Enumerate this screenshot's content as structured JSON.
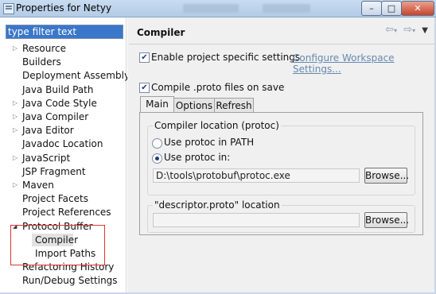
{
  "window": {
    "title": "Properties for Netyy",
    "buttons": {
      "minimize": "–",
      "maximize": "□",
      "close": "✕"
    }
  },
  "filter": {
    "value": "type filter text"
  },
  "tree": {
    "items": [
      {
        "label": "Resource",
        "expandable": true
      },
      {
        "label": "Builders",
        "expandable": false
      },
      {
        "label": "Deployment Assembly",
        "expandable": false
      },
      {
        "label": "Java Build Path",
        "expandable": false
      },
      {
        "label": "Java Code Style",
        "expandable": true
      },
      {
        "label": "Java Compiler",
        "expandable": true
      },
      {
        "label": "Java Editor",
        "expandable": true
      },
      {
        "label": "Javadoc Location",
        "expandable": false
      },
      {
        "label": "JavaScript",
        "expandable": true
      },
      {
        "label": "JSP Fragment",
        "expandable": false
      },
      {
        "label": "Maven",
        "expandable": true
      },
      {
        "label": "Project Facets",
        "expandable": false
      },
      {
        "label": "Project References",
        "expandable": false
      },
      {
        "label": "Protocol Buffer",
        "expandable": true,
        "expanded": true
      },
      {
        "label": "Compiler",
        "child": true,
        "selected": true
      },
      {
        "label": "Import Paths",
        "child": true
      },
      {
        "label": "Refactoring History",
        "expandable": false
      },
      {
        "label": "Run/Debug Settings",
        "expandable": false
      }
    ]
  },
  "page": {
    "title": "Compiler",
    "nav_icons": [
      "back-arrow-icon",
      "back-dropdown-icon",
      "forward-arrow-icon",
      "forward-dropdown-icon",
      "view-menu-icon"
    ],
    "enable_specific": {
      "label": "Enable project specific settings",
      "checked": true
    },
    "configure_link": "Configure Workspace Settings...",
    "compile_on_save": {
      "label": "Compile .proto files on save",
      "checked": true
    },
    "tabs": [
      "Main",
      "Options",
      "Refresh"
    ],
    "active_tab": "Main",
    "compiler_group": {
      "title": "Compiler location (protoc)",
      "radio_path": "Use protoc in PATH",
      "radio_custom": "Use protoc in:",
      "selected": "custom",
      "path_value": "D:\\tools\\protobuf\\protoc.exe",
      "browse_label": "Browse..."
    },
    "descriptor_group": {
      "title": "\"descriptor.proto\" location",
      "path_value": "",
      "browse_label": "Browse..."
    }
  }
}
